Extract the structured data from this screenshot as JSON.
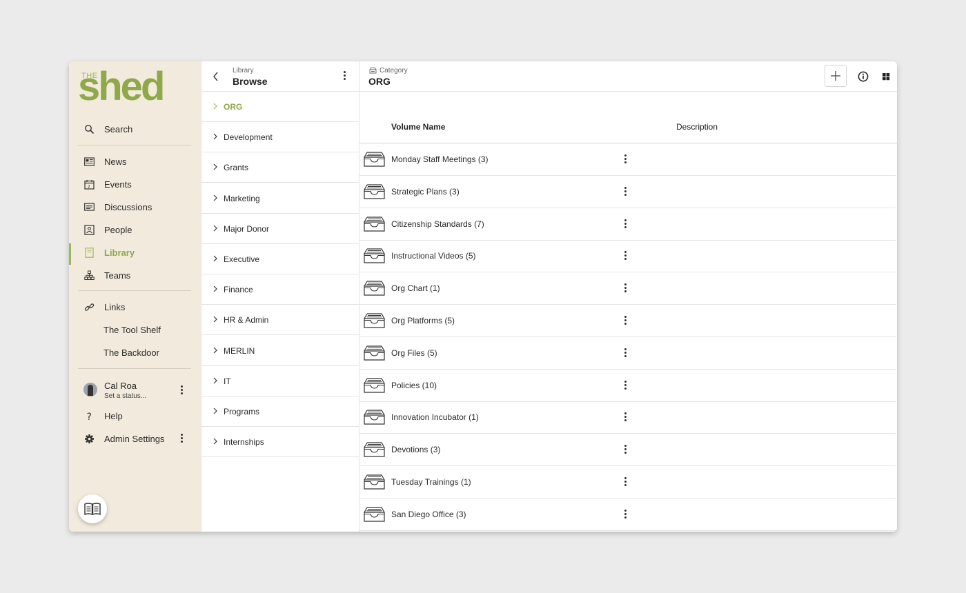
{
  "brand": {
    "small": "THE",
    "word": "shed"
  },
  "sidebar": {
    "search": {
      "label": "Search",
      "icon": "search-icon"
    },
    "items": [
      {
        "label": "News",
        "icon": "newspaper-icon",
        "active": false
      },
      {
        "label": "Events",
        "icon": "calendar-icon",
        "active": false
      },
      {
        "label": "Discussions",
        "icon": "message-icon",
        "active": false
      },
      {
        "label": "People",
        "icon": "person-card-icon",
        "active": false
      },
      {
        "label": "Library",
        "icon": "book-icon",
        "active": true
      },
      {
        "label": "Teams",
        "icon": "org-chart-icon",
        "active": false
      }
    ],
    "links": {
      "label": "Links",
      "icon": "link-icon",
      "items": [
        "The Tool Shelf",
        "The Backdoor"
      ]
    },
    "user": {
      "name": "Cal Roa",
      "status": "Set a status..."
    },
    "help": {
      "label": "Help",
      "icon": "question-icon"
    },
    "admin": {
      "label": "Admin Settings",
      "icon": "gear-icon"
    },
    "accent": "#8fa84a",
    "background": "#f2ebdd"
  },
  "browse": {
    "subtitle": "Library",
    "title": "Browse",
    "categories": [
      "ORG",
      "Development",
      "Grants",
      "Marketing",
      "Major Donor",
      "Executive",
      "Finance",
      "HR & Admin",
      "MERLIN",
      "IT",
      "Programs",
      "Internships"
    ],
    "active_index": 0
  },
  "main": {
    "subtitle": "Category",
    "title": "ORG",
    "columns": {
      "name": "Volume Name",
      "description": "Description"
    },
    "volumes": [
      "Monday Staff Meetings (3)",
      "Strategic Plans (3)",
      "Citizenship Standards (7)",
      "Instructional Videos (5)",
      "Org Chart (1)",
      "Org Platforms (5)",
      "Org Files (5)",
      "Policies (10)",
      "Innovation Incubator (1)",
      "Devotions (3)",
      "Tuesday Trainings (1)",
      "San Diego Office (3)"
    ]
  }
}
